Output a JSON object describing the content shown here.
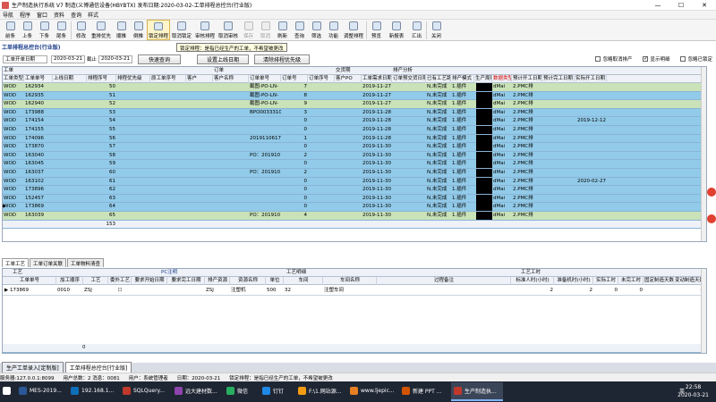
{
  "window": {
    "title": "生产制造执行系统 V7 制造(义博通信设备(HBYBTX) 发布日期:2020-03-02-工单排程总控台(行业版)",
    "minimize": "—",
    "maximize": "☐",
    "close": "✕"
  },
  "menu": [
    "导航",
    "程序",
    "窗口",
    "资料",
    "查询",
    "样式"
  ],
  "toolbar": [
    {
      "label": "前条",
      "icon": "first-icon",
      "sel": false,
      "dis": false
    },
    {
      "label": "上条",
      "icon": "prev-icon",
      "sel": false,
      "dis": false
    },
    {
      "label": "下条",
      "icon": "next-icon",
      "sel": false,
      "dis": false
    },
    {
      "label": "尾条",
      "icon": "last-icon",
      "sel": false,
      "dis": false
    },
    {
      "sep": true
    },
    {
      "label": "修改",
      "icon": "edit-icon",
      "sel": false,
      "dis": false
    },
    {
      "label": "重排优先",
      "icon": "reorder-icon",
      "sel": false,
      "dis": false
    },
    {
      "label": "顺推",
      "icon": "forward-icon",
      "sel": false,
      "dis": false
    },
    {
      "label": "倒推",
      "icon": "backward-icon",
      "sel": false,
      "dis": false
    },
    {
      "label": "锁定排程",
      "icon": "lock-icon",
      "sel": true,
      "dis": false
    },
    {
      "label": "取消锁定",
      "icon": "unlock-icon",
      "sel": false,
      "dis": false
    },
    {
      "label": "审核排程",
      "icon": "approve-icon",
      "sel": false,
      "dis": false
    },
    {
      "label": "取消审核",
      "icon": "unapprove-icon",
      "sel": false,
      "dis": false
    },
    {
      "label": "保存",
      "icon": "save-icon",
      "sel": false,
      "dis": true
    },
    {
      "label": "取消",
      "icon": "cancel-icon",
      "sel": false,
      "dis": true
    },
    {
      "label": "刷新",
      "icon": "refresh-icon",
      "sel": false,
      "dis": false
    },
    {
      "label": "查询",
      "icon": "query-icon",
      "sel": false,
      "dis": false
    },
    {
      "label": "筛选",
      "icon": "filter-icon",
      "sel": false,
      "dis": false
    },
    {
      "label": "功能",
      "icon": "function-icon",
      "sel": false,
      "dis": false
    },
    {
      "label": "调整排程",
      "icon": "adjust-icon",
      "sel": false,
      "dis": false
    },
    {
      "sep": true
    },
    {
      "label": "预览",
      "icon": "preview-icon",
      "sel": false,
      "dis": false
    },
    {
      "label": "新报表",
      "icon": "report-icon",
      "sel": false,
      "dis": false
    },
    {
      "label": "汇出",
      "icon": "export-icon",
      "sel": false,
      "dis": false
    },
    {
      "sep": true
    },
    {
      "label": "关闭",
      "icon": "close-icon",
      "sel": false,
      "dis": false
    }
  ],
  "tooltip": "锁定排程：是指已经生产的工单，不希望被更改",
  "section_title": "工单排程总控台(行业版)",
  "filter": {
    "date_field": "工单开单日期",
    "date_from": "2020-03-21",
    "to_label": "截止",
    "date_to": "2020-03-21",
    "btn_query": "快速查询",
    "btn_set_date": "设置上线日期",
    "btn_clear": "清除排程优先级",
    "chk_show_cancel": "忽略取消排产",
    "chk_show_detail": "显示明细",
    "chk_ignore_done": "忽略已锁定"
  },
  "grid": {
    "groups": [
      "工单",
      "订单",
      "交货期",
      "排产分析"
    ],
    "headers": [
      "工单类型",
      "工单单号",
      "上线日期",
      "排程序号",
      "排程优先级",
      "原工单序号",
      "客户",
      "客户名称",
      "订单单号",
      "订单号",
      "订单序号",
      "客户PO",
      "工单需求日期",
      "订单预交货日期",
      "已有工艺路线",
      "排产模式",
      "生产周期",
      "数据类型",
      "预计开工日期",
      "预计完工日期",
      "实际开工日期"
    ],
    "rows": [
      [
        "WOD",
        "162934",
        "",
        "50",
        "",
        "",
        "",
        "",
        "截图-PO-LN-",
        "7",
        "",
        "",
        "2019-11-27",
        "",
        "N,未完成",
        "1.插件",
        "",
        "dMai",
        "2.PMC排",
        "",
        "",
        "",
        ""
      ],
      [
        "WOD",
        "162935",
        "",
        "51",
        "",
        "",
        "",
        "",
        "截图-PO-LN-",
        "8",
        "",
        "",
        "2019-11-27",
        "",
        "N,未完成",
        "1.插件",
        "",
        "dMai",
        "2.PMC排",
        "",
        "",
        "",
        ""
      ],
      [
        "WOD",
        "162940",
        "",
        "52",
        "",
        "",
        "",
        "",
        "截图-PO-LN-",
        "9",
        "",
        "",
        "2019-11-27",
        "",
        "N,未完成",
        "1.插件",
        "",
        "dMai",
        "2.PMC排",
        "",
        "",
        "",
        ""
      ],
      [
        "WOD",
        "173988",
        "",
        "53",
        "",
        "",
        "",
        "",
        "BPO0033310",
        "3",
        "",
        "",
        "2019-11-28",
        "",
        "N,未完成",
        "1.插件",
        "",
        "dMai",
        "2.PMC排",
        "",
        "",
        "",
        ""
      ],
      [
        "WOD",
        "174154",
        "",
        "54",
        "",
        "",
        "",
        "",
        "",
        "0",
        "",
        "",
        "2019-11-28",
        "",
        "N,未完成",
        "1.插件",
        "",
        "dMai",
        "2.PMC排",
        "",
        "",
        "2019-12-12",
        ""
      ],
      [
        "WOD",
        "174155",
        "",
        "55",
        "",
        "",
        "",
        "",
        "",
        "0",
        "",
        "",
        "2019-11-28",
        "",
        "N,未完成",
        "1.插件",
        "",
        "dMai",
        "2.PMC排",
        "",
        "",
        "",
        ""
      ],
      [
        "WOD",
        "174096",
        "",
        "56",
        "",
        "",
        "",
        "",
        "2019110617",
        "1",
        "",
        "",
        "2019-11-28",
        "",
        "N,未完成",
        "1.插件",
        "",
        "dMai",
        "2.PMC排",
        "",
        "",
        "",
        ""
      ],
      [
        "WOD",
        "173870",
        "",
        "57",
        "",
        "",
        "",
        "",
        "",
        "0",
        "",
        "",
        "2019-11-30",
        "",
        "N,未完成",
        "1.插件",
        "",
        "dMai",
        "2.PMC排",
        "",
        "",
        "",
        ""
      ],
      [
        "WOD",
        "163040",
        "",
        "58",
        "",
        "",
        "",
        "",
        "PO：201910",
        "2",
        "",
        "",
        "2019-11-30",
        "",
        "N,未完成",
        "1.插件",
        "",
        "dMai",
        "2.PMC排",
        "",
        "",
        "",
        ""
      ],
      [
        "WOD",
        "163045",
        "",
        "59",
        "",
        "",
        "",
        "",
        "",
        "0",
        "",
        "",
        "2019-11-30",
        "",
        "N,未完成",
        "1.插件",
        "",
        "dMai",
        "2.PMC排",
        "",
        "",
        "",
        ""
      ],
      [
        "WOD",
        "163037",
        "",
        "60",
        "",
        "",
        "",
        "",
        "PO：201910",
        "2",
        "",
        "",
        "2019-11-30",
        "",
        "N,未完成",
        "1.插件",
        "",
        "dMai",
        "2.PMC排",
        "",
        "",
        "",
        ""
      ],
      [
        "WOD",
        "163102",
        "",
        "61",
        "",
        "",
        "",
        "",
        "",
        "0",
        "",
        "",
        "2019-11-30",
        "",
        "N,未完成",
        "1.插件",
        "",
        "dMai",
        "2.PMC排",
        "",
        "",
        "2020-02-27",
        ""
      ],
      [
        "WOD",
        "173896",
        "",
        "62",
        "",
        "",
        "",
        "",
        "",
        "0",
        "",
        "",
        "2019-11-30",
        "",
        "N,未完成",
        "1.插件",
        "",
        "dMai",
        "2.PMC排",
        "",
        "",
        "",
        ""
      ],
      [
        "WOD",
        "152457",
        "",
        "63",
        "",
        "",
        "",
        "",
        "",
        "0",
        "",
        "",
        "2019-11-30",
        "",
        "N,未完成",
        "1.插件",
        "",
        "dMai",
        "2.PMC排",
        "",
        "",
        "",
        ""
      ],
      [
        "WOD",
        "173869",
        "",
        "64",
        "",
        "",
        "",
        "",
        "",
        "0",
        "",
        "",
        "2019-11-30",
        "",
        "N,未完成",
        "1.插件",
        "",
        "dMai",
        "2.PMC排",
        "",
        "",
        "",
        ""
      ],
      [
        "WOD",
        "163039",
        "",
        "65",
        "",
        "",
        "",
        "",
        "PO：201910",
        "4",
        "",
        "",
        "2019-11-30",
        "",
        "N,未完成",
        "1.插件",
        "",
        "dMai",
        "2.PMC排",
        "",
        "",
        "",
        ""
      ]
    ],
    "footer_count": "153"
  },
  "lower_tabs": [
    "工单工艺",
    "工单订单关联",
    "工单物料清查"
  ],
  "lower": {
    "groups": [
      "工艺",
      "PC注明",
      "工艺明细",
      "工艺工时"
    ],
    "headers": [
      "工单单号",
      "加工顺序",
      "工艺",
      "委外工艺",
      "要求开始日期",
      "要求完工日期",
      "排产资源",
      "资源名称",
      "单位",
      "车间",
      "车间名称",
      "过程备注",
      "标准人时(小时)",
      "准备机时(小时)",
      "实际工时",
      "未完工时",
      "固定制造天数",
      "变动制造天数"
    ],
    "row": [
      "173869",
      "0010",
      "ZSJ",
      "☐",
      "",
      "",
      "ZSJ",
      "注塑机",
      "500",
      "32",
      "注塑车间",
      "",
      "2",
      "2",
      "0",
      "0",
      "",
      "0"
    ],
    "footer": "0"
  },
  "bottom_tabs": [
    "生产工单录入[定制版]",
    "工单排程总控台[行业版]"
  ],
  "status": {
    "server": "服务器:127.0.0.1:8099",
    "users": "用户总数：2 消息：0081",
    "user": "用户：系统管理者",
    "date": "日期：2020-03-21",
    "hint": "锁定排程：是指已经生产的工单，不希望被更改"
  },
  "taskbar": {
    "items": [
      "MES-2019...",
      "192.168.1...",
      "SQLQuery...",
      "远大建材数...",
      "微信",
      "钉钉",
      "F:\\1.网站源...",
      "www.ljepic...",
      "新建 PPT ...",
      "生产制造执..."
    ],
    "time": "22:58",
    "date": "2020-03-21",
    "lang": "英"
  },
  "colors": {
    "row_green": "#c9e2b8",
    "row_blue": "#92cbe9",
    "row_sel": "#f7f7f7",
    "title_blue": "#1c3e8c"
  }
}
